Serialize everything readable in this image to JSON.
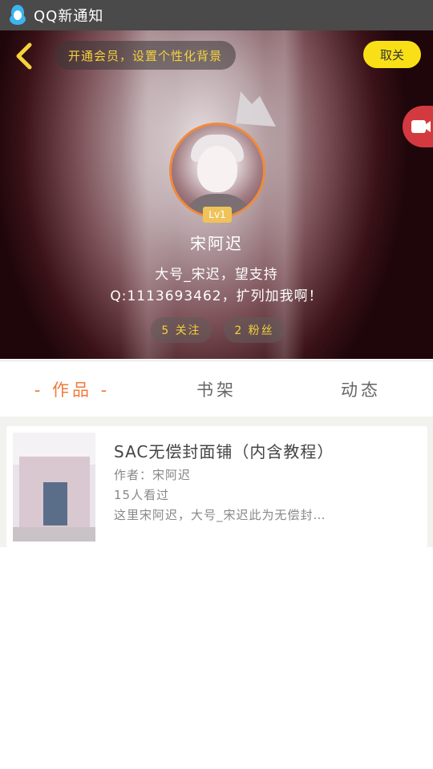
{
  "status_bar": {
    "app_title": "QQ新通知",
    "icon": "qq-penguin-icon"
  },
  "header": {
    "back_icon": "chevron-left-icon",
    "vip_prompt": "开通会员，设置个性化背景",
    "cancel_label": "取关",
    "camera_icon": "camera-icon",
    "level_badge": "Lv1",
    "username": "宋阿迟",
    "bio_line1": "大号_宋迟，望支持",
    "bio_line2": "Q:1113693462，扩列加我啊！",
    "follow_stat": "5 关注",
    "fans_stat": "2 粉丝",
    "colors": {
      "accent_yellow": "#f9e016",
      "avatar_ring": "#f08a3c",
      "stat_text": "#f4d23c"
    }
  },
  "tabs": [
    {
      "label": "- 作品 -",
      "active": true
    },
    {
      "label": "书架",
      "active": false
    },
    {
      "label": "动态",
      "active": false
    }
  ],
  "works": [
    {
      "title": "SAC无偿封面铺（内含教程）",
      "author": "作者：宋阿迟",
      "views": "15人看过",
      "description": "这里宋阿迟，大号_宋迟此为无偿封…"
    }
  ],
  "colors": {
    "tab_active": "#f07a3a",
    "list_background": "#f2f2ee"
  }
}
